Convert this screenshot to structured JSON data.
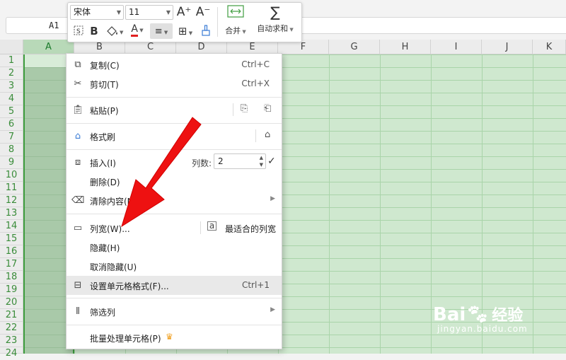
{
  "namebox": "A1",
  "toolbar": {
    "font_name": "宋体",
    "font_size": "11",
    "increase_font_icon": "A⁺",
    "decrease_font_icon": "A⁻",
    "merge_label": "合并",
    "autosum_label": "自动求和",
    "bold_label": "B",
    "font_color_letter": "A",
    "font_color": "#e02020"
  },
  "columns": [
    "A",
    "B",
    "C",
    "D",
    "E",
    "F",
    "G",
    "H",
    "I",
    "J",
    "K"
  ],
  "rows": [
    "1",
    "2",
    "3",
    "4",
    "5",
    "6",
    "7",
    "8",
    "9",
    "10",
    "11",
    "12",
    "13",
    "14",
    "15",
    "16",
    "17",
    "18",
    "19",
    "20",
    "21",
    "22",
    "23",
    "24"
  ],
  "selected_column": "A",
  "context_menu": {
    "copy": {
      "label": "复制(C)",
      "shortcut": "Ctrl+C"
    },
    "cut": {
      "label": "剪切(T)",
      "shortcut": "Ctrl+X"
    },
    "paste": {
      "label": "粘贴(P)"
    },
    "format_painter": {
      "label": "格式刷"
    },
    "insert": {
      "label": "插入(I)",
      "count_label": "列数:",
      "count_value": "2"
    },
    "delete": {
      "label": "删除(D)"
    },
    "clear": {
      "label": "清除内容(N)"
    },
    "col_width": {
      "label": "列宽(W)...",
      "best_fit": "最适合的列宽"
    },
    "hide": {
      "label": "隐藏(H)"
    },
    "unhide": {
      "label": "取消隐藏(U)"
    },
    "format_cells": {
      "label": "设置单元格格式(F)...",
      "shortcut": "Ctrl+1"
    },
    "filter_col": {
      "label": "筛选列"
    },
    "batch": {
      "label": "批量处理单元格(P)"
    }
  },
  "watermark": {
    "brand": "Bai",
    "brand2": "经验",
    "url": "jingyan.baidu.com"
  },
  "colors": {
    "accent_green": "#3f9d3f",
    "arrow_red": "#ee1111",
    "crown": "#f0a020"
  }
}
